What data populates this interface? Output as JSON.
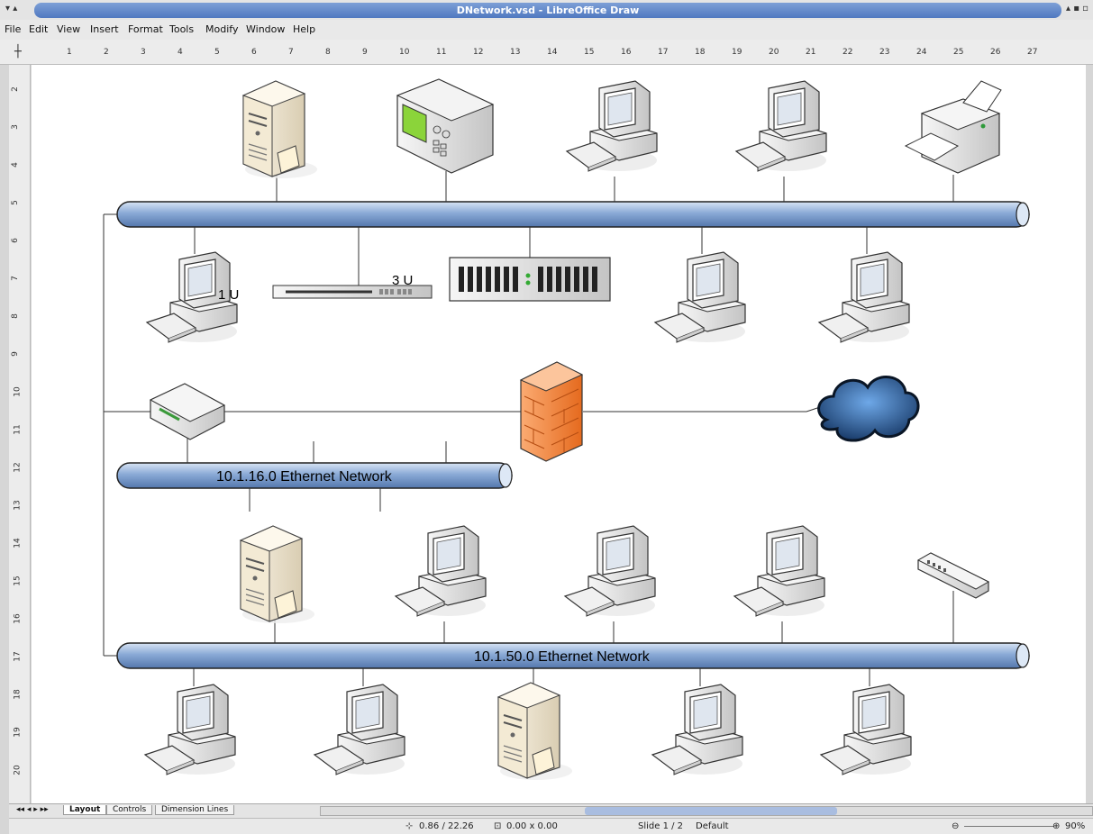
{
  "window": {
    "title": "DNetwork.vsd - LibreOffice Draw"
  },
  "menu": [
    "File",
    "Edit",
    "View",
    "Insert",
    "Format",
    "Tools",
    "Modify",
    "Window",
    "Help"
  ],
  "ruler": {
    "h_ticks": [
      "1",
      "2",
      "3",
      "4",
      "5",
      "6",
      "7",
      "8",
      "9",
      "10",
      "11",
      "12",
      "13",
      "14",
      "15",
      "16",
      "17",
      "18",
      "19",
      "20",
      "21",
      "22",
      "23",
      "24",
      "25",
      "26",
      "27"
    ],
    "v_ticks": [
      "2",
      "3",
      "4",
      "5",
      "6",
      "7",
      "8",
      "9",
      "10",
      "11",
      "12",
      "13",
      "14",
      "15",
      "16",
      "17",
      "18",
      "19",
      "20"
    ]
  },
  "diagram": {
    "labels": {
      "rack_1u": "1 U",
      "rack_3u": "3 U",
      "net_16": "10.1.16.0 Ethernet Network",
      "net_50": "10.1.50.0 Ethernet Network"
    }
  },
  "tabs": [
    "Layout",
    "Controls",
    "Dimension Lines"
  ],
  "status": {
    "position": "0.86 / 22.26",
    "size": "0.00 x 0.00",
    "slide": "Slide 1 / 2",
    "layout": "Default",
    "zoom": "90%"
  },
  "colors": {
    "pipe": "#8aaad6",
    "title_bg": "#5a82c6",
    "firewall": "#f07a33"
  },
  "icons": [
    "server-icon",
    "monitor-device-icon",
    "workstation-icon",
    "printer-icon",
    "rack-switch-icon",
    "rack-server-icon",
    "router-icon",
    "firewall-icon",
    "cloud-icon",
    "hub-icon"
  ]
}
